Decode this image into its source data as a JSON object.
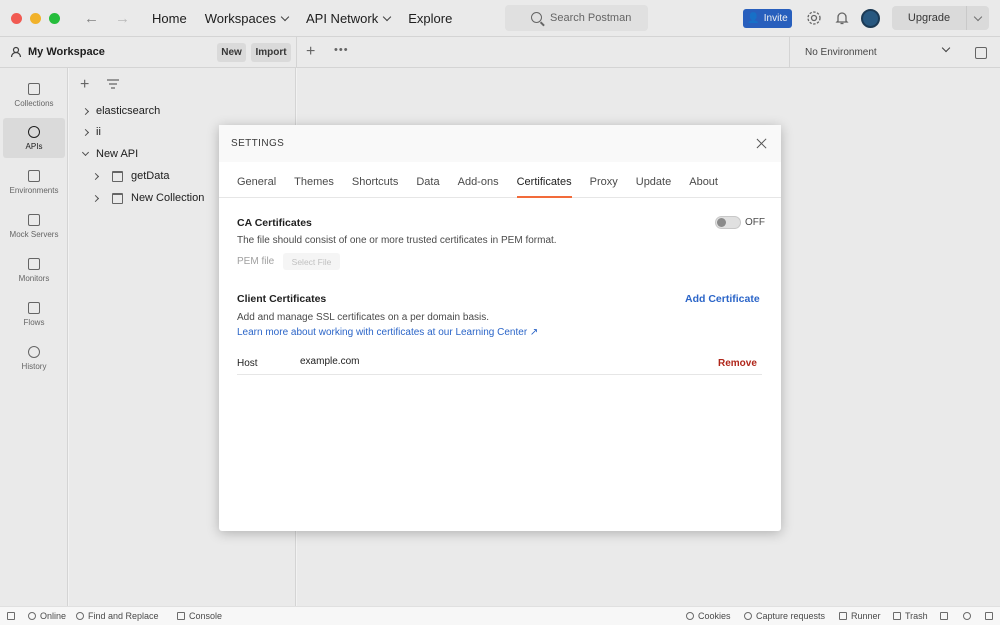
{
  "topbar": {
    "nav": [
      {
        "label": "Home",
        "dropdown": false
      },
      {
        "label": "Workspaces",
        "dropdown": true
      },
      {
        "label": "API Network",
        "dropdown": true
      },
      {
        "label": "Explore",
        "dropdown": false
      }
    ],
    "search_placeholder": "Search Postman",
    "invite_label": "Invite",
    "upgrade_label": "Upgrade"
  },
  "workspace": {
    "title": "My Workspace",
    "new_label": "New",
    "import_label": "Import",
    "environment": "No Environment"
  },
  "rail": [
    {
      "label": "Collections",
      "icon": "collections-icon",
      "active": false
    },
    {
      "label": "APIs",
      "icon": "apis-icon",
      "active": true
    },
    {
      "label": "Environments",
      "icon": "environments-icon",
      "active": false
    },
    {
      "label": "Mock Servers",
      "icon": "mock-servers-icon",
      "active": false
    },
    {
      "label": "Monitors",
      "icon": "monitors-icon",
      "active": false
    },
    {
      "label": "Flows",
      "icon": "flows-icon",
      "active": false
    },
    {
      "label": "History",
      "icon": "history-icon",
      "active": false
    }
  ],
  "tree": [
    {
      "label": "elasticsearch",
      "expanded": false,
      "depth": 0
    },
    {
      "label": "ii",
      "expanded": false,
      "depth": 0
    },
    {
      "label": "New API",
      "expanded": true,
      "depth": 0
    },
    {
      "label": "getData",
      "expanded": false,
      "depth": 1
    },
    {
      "label": "New Collection",
      "expanded": false,
      "depth": 1
    }
  ],
  "settings": {
    "title": "SETTINGS",
    "tabs": [
      "General",
      "Themes",
      "Shortcuts",
      "Data",
      "Add-ons",
      "Certificates",
      "Proxy",
      "Update",
      "About"
    ],
    "active_tab": "Certificates",
    "ca": {
      "title": "CA Certificates",
      "description": "The file should consist of one or more trusted certificates in PEM format.",
      "toggle_state": "OFF",
      "pem_label": "PEM file",
      "select_file_label": "Select File"
    },
    "client": {
      "title": "Client Certificates",
      "add_label": "Add Certificate",
      "description": "Add and manage SSL certificates on a per domain basis.",
      "learn_more": "Learn more about working with certificates at our Learning Center ↗",
      "host_label": "Host",
      "host_value": "example.com",
      "remove_label": "Remove"
    }
  },
  "statusbar": {
    "left": [
      "Online",
      "Find and Replace",
      "Console"
    ],
    "right": [
      "Cookies",
      "Capture requests",
      "Runner",
      "Trash"
    ]
  },
  "colors": {
    "accent": "#f26b3a",
    "link": "#2b65c8",
    "danger": "#b0261a"
  }
}
